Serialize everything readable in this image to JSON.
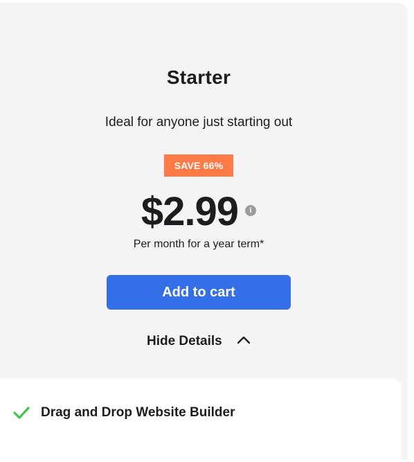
{
  "plan": {
    "title": "Starter",
    "subtitle": "Ideal for anyone just starting out",
    "badge": "SAVE 66%",
    "price": "$2.99",
    "info_glyph": "i",
    "term": "Per month for a year term*",
    "cta_label": "Add to cart",
    "toggle_label": "Hide Details"
  },
  "features": [
    {
      "label": "Drag and Drop Website Builder",
      "icon": "check-icon"
    }
  ],
  "colors": {
    "card_background": "#f4f4f4",
    "badge": "#ff7a45",
    "cta": "#356fe8",
    "check": "#3cc453",
    "text": "#1d1d1f",
    "info_icon": "#9d9d9d"
  }
}
